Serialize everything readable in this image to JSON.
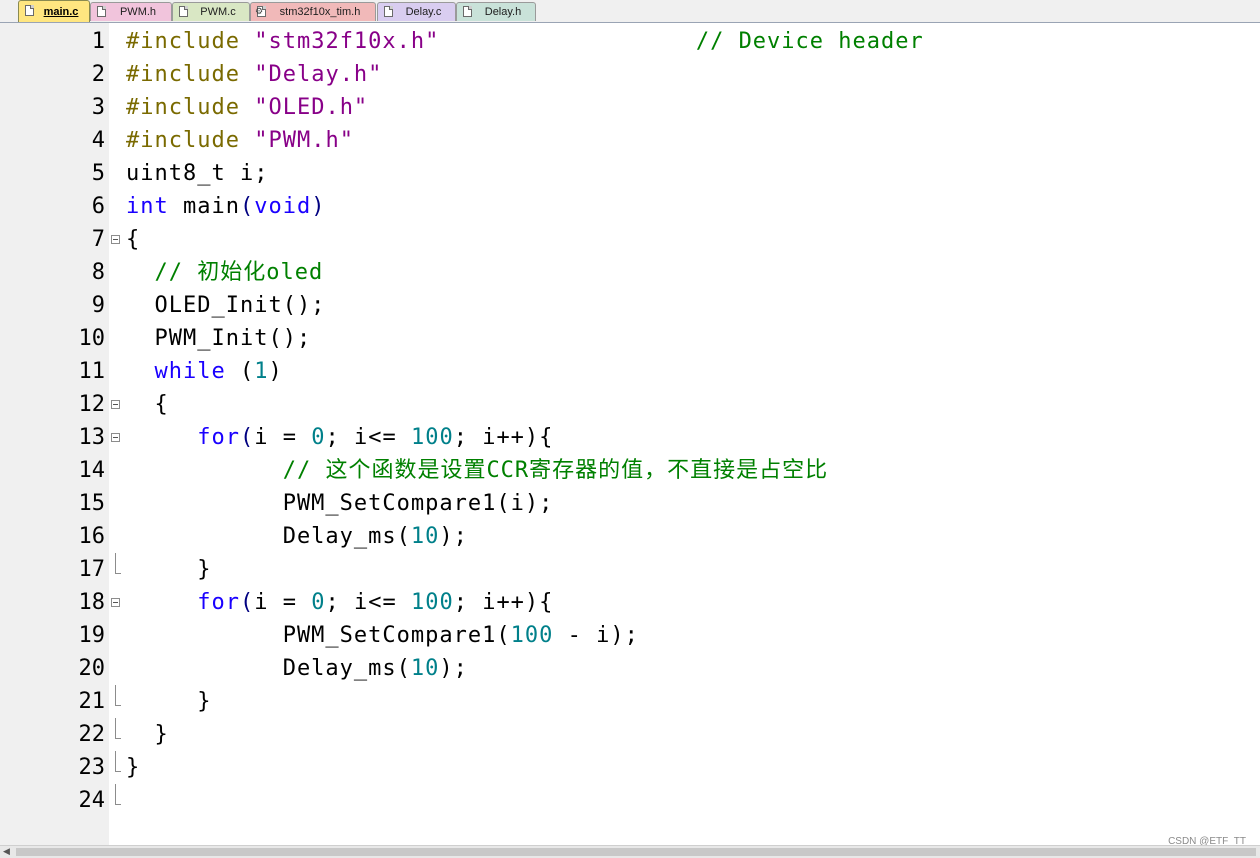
{
  "tabs": [
    {
      "label": "main.c",
      "active": true,
      "color": "#ffe680",
      "icon": "document-icon"
    },
    {
      "label": "PWM.h",
      "active": false,
      "color": "#f1c4dc",
      "icon": "document-icon"
    },
    {
      "label": "PWM.c",
      "active": false,
      "color": "#d9e7c4",
      "icon": "document-icon"
    },
    {
      "label": "stm32f10x_tim.h",
      "active": false,
      "color": "#f1b9b9",
      "icon": "gear-document-icon"
    },
    {
      "label": "Delay.c",
      "active": false,
      "color": "#d9cdf0",
      "icon": "document-icon"
    },
    {
      "label": "Delay.h",
      "active": false,
      "color": "#c9e2d9",
      "icon": "document-icon"
    }
  ],
  "editor": {
    "lines": [
      {
        "n": "1",
        "fold": "",
        "parts": [
          [
            "pp",
            "#include "
          ],
          [
            "str",
            "\"stm32f10x.h\""
          ],
          [
            "",
            "                  "
          ],
          [
            "cmt",
            "// Device header"
          ]
        ]
      },
      {
        "n": "2",
        "fold": "",
        "parts": [
          [
            "pp",
            "#include "
          ],
          [
            "str",
            "\"Delay.h\""
          ]
        ]
      },
      {
        "n": "3",
        "fold": "",
        "parts": [
          [
            "pp",
            "#include "
          ],
          [
            "str",
            "\"OLED.h\""
          ]
        ]
      },
      {
        "n": "4",
        "fold": "",
        "parts": [
          [
            "pp",
            "#include "
          ],
          [
            "str",
            "\"PWM.h\""
          ]
        ]
      },
      {
        "n": "5",
        "fold": "",
        "parts": [
          [
            "",
            "uint8_t i;"
          ]
        ]
      },
      {
        "n": "6",
        "fold": "",
        "parts": [
          [
            "kw",
            "int"
          ],
          [
            "",
            " main"
          ],
          [
            "pn",
            "("
          ],
          [
            "kw",
            "void"
          ],
          [
            "pn",
            ")"
          ]
        ]
      },
      {
        "n": "7",
        "fold": "open",
        "parts": [
          [
            "",
            "{"
          ]
        ]
      },
      {
        "n": "8",
        "fold": "",
        "parts": [
          [
            "",
            "  "
          ],
          [
            "cmt",
            "// 初始化oled"
          ]
        ]
      },
      {
        "n": "9",
        "fold": "",
        "parts": [
          [
            "",
            "  OLED_Init();"
          ]
        ]
      },
      {
        "n": "10",
        "fold": "",
        "parts": [
          [
            "",
            "  PWM_Init();"
          ]
        ]
      },
      {
        "n": "11",
        "fold": "",
        "parts": [
          [
            "",
            "  "
          ],
          [
            "kw",
            "while"
          ],
          [
            "",
            " ("
          ],
          [
            "num",
            "1"
          ],
          [
            "",
            ")"
          ]
        ]
      },
      {
        "n": "12",
        "fold": "open",
        "parts": [
          [
            "",
            "  {"
          ]
        ]
      },
      {
        "n": "13",
        "fold": "open",
        "parts": [
          [
            "",
            "     "
          ],
          [
            "kw",
            "for"
          ],
          [
            "pn",
            "("
          ],
          [
            "",
            "i = "
          ],
          [
            "num",
            "0"
          ],
          [
            "",
            "; i<= "
          ],
          [
            "num",
            "100"
          ],
          [
            "",
            "; i++){"
          ]
        ]
      },
      {
        "n": "14",
        "fold": "",
        "parts": [
          [
            "",
            "           "
          ],
          [
            "cmt",
            "// 这个函数是设置CCR寄存器的值，不直接是占空比"
          ]
        ]
      },
      {
        "n": "15",
        "fold": "",
        "parts": [
          [
            "",
            "           PWM_SetCompare1(i);"
          ]
        ]
      },
      {
        "n": "16",
        "fold": "",
        "parts": [
          [
            "",
            "           Delay_ms("
          ],
          [
            "num",
            "10"
          ],
          [
            "",
            ");"
          ]
        ]
      },
      {
        "n": "17",
        "fold": "end",
        "parts": [
          [
            "",
            "     }"
          ]
        ]
      },
      {
        "n": "18",
        "fold": "open",
        "parts": [
          [
            "",
            "     "
          ],
          [
            "kw",
            "for"
          ],
          [
            "pn",
            "("
          ],
          [
            "",
            "i = "
          ],
          [
            "num",
            "0"
          ],
          [
            "",
            "; i<= "
          ],
          [
            "num",
            "100"
          ],
          [
            "",
            "; i++){"
          ]
        ]
      },
      {
        "n": "19",
        "fold": "",
        "parts": [
          [
            "",
            "           PWM_SetCompare1("
          ],
          [
            "num",
            "100"
          ],
          [
            "",
            " - i);"
          ]
        ]
      },
      {
        "n": "20",
        "fold": "",
        "parts": [
          [
            "",
            "           Delay_ms("
          ],
          [
            "num",
            "10"
          ],
          [
            "",
            ");"
          ]
        ]
      },
      {
        "n": "21",
        "fold": "end",
        "parts": [
          [
            "",
            "     }"
          ]
        ]
      },
      {
        "n": "22",
        "fold": "end",
        "parts": [
          [
            "",
            "  }"
          ]
        ]
      },
      {
        "n": "23",
        "fold": "end",
        "parts": [
          [
            "",
            "}"
          ]
        ]
      },
      {
        "n": "24",
        "fold": "end",
        "parts": [
          [
            "",
            ""
          ]
        ]
      }
    ]
  },
  "watermark": "CSDN @ETF_TT"
}
